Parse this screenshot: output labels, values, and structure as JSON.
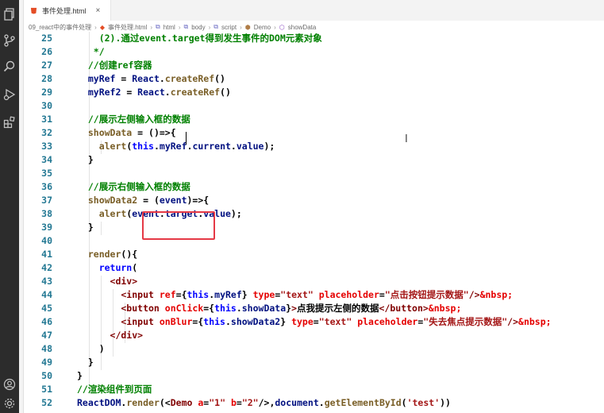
{
  "tab": {
    "title": "事件处理.html",
    "close": "×"
  },
  "breadcrumb": [
    "09_react中的事件处理",
    "事件处理.html",
    "html",
    "body",
    "script",
    "Demo",
    "showData"
  ],
  "lines": [
    {
      "n": "25",
      "segs": [
        [
          "c",
          "    (2).通过event.target得到发生事件的DOM元素对象"
        ]
      ]
    },
    {
      "n": "26",
      "segs": [
        [
          "c",
          "   */"
        ]
      ]
    },
    {
      "n": "27",
      "segs": [
        [
          "c",
          "  //创建ref容器"
        ]
      ]
    },
    {
      "n": "28",
      "segs": [
        [
          "v",
          "  myRef"
        ],
        [
          "p",
          " = "
        ],
        [
          "v",
          "React"
        ],
        [
          "p",
          "."
        ],
        [
          "f",
          "createRef"
        ],
        [
          "p",
          "()"
        ]
      ]
    },
    {
      "n": "29",
      "segs": [
        [
          "v",
          "  myRef2"
        ],
        [
          "p",
          " = "
        ],
        [
          "v",
          "React"
        ],
        [
          "p",
          "."
        ],
        [
          "f",
          "createRef"
        ],
        [
          "p",
          "()"
        ]
      ]
    },
    {
      "n": "30",
      "segs": []
    },
    {
      "n": "31",
      "segs": [
        [
          "c",
          "  //展示左侧输入框的数据"
        ]
      ]
    },
    {
      "n": "32",
      "segs": [
        [
          "f",
          "  showData"
        ],
        [
          "p",
          " = ()=>{"
        ]
      ]
    },
    {
      "n": "33",
      "segs": [
        [
          "f",
          "    alert"
        ],
        [
          "p",
          "("
        ],
        [
          "k",
          "this"
        ],
        [
          "p",
          "."
        ],
        [
          "v",
          "myRef"
        ],
        [
          "p",
          "."
        ],
        [
          "v",
          "current"
        ],
        [
          "p",
          "."
        ],
        [
          "v",
          "value"
        ],
        [
          "p",
          ");"
        ]
      ]
    },
    {
      "n": "34",
      "segs": [
        [
          "p",
          "  }"
        ]
      ]
    },
    {
      "n": "35",
      "segs": []
    },
    {
      "n": "36",
      "segs": [
        [
          "c",
          "  //展示右侧输入框的数据"
        ]
      ]
    },
    {
      "n": "37",
      "segs": [
        [
          "f",
          "  showData2"
        ],
        [
          "p",
          " = ("
        ],
        [
          "v",
          "event"
        ],
        [
          "p",
          ")=>{"
        ]
      ]
    },
    {
      "n": "38",
      "segs": [
        [
          "f",
          "    alert"
        ],
        [
          "p",
          "("
        ],
        [
          "v",
          "event"
        ],
        [
          "p",
          "."
        ],
        [
          "v",
          "target"
        ],
        [
          "p",
          "."
        ],
        [
          "v",
          "value"
        ],
        [
          "p",
          ");"
        ]
      ]
    },
    {
      "n": "39",
      "segs": [
        [
          "p",
          "  }"
        ]
      ]
    },
    {
      "n": "40",
      "segs": []
    },
    {
      "n": "41",
      "segs": [
        [
          "f",
          "  render"
        ],
        [
          "p",
          "(){"
        ]
      ]
    },
    {
      "n": "42",
      "segs": [
        [
          "k",
          "    return"
        ],
        [
          "p",
          "("
        ]
      ]
    },
    {
      "n": "43",
      "segs": [
        [
          "t",
          "      <div>"
        ]
      ]
    },
    {
      "n": "44",
      "segs": [
        [
          "t",
          "        <input"
        ],
        [
          "a",
          " ref"
        ],
        [
          "p",
          "={"
        ],
        [
          "k",
          "this"
        ],
        [
          "p",
          "."
        ],
        [
          "v",
          "myRef"
        ],
        [
          "p",
          "}"
        ],
        [
          "a",
          " type"
        ],
        [
          "p",
          "="
        ],
        [
          "s",
          "\"text\""
        ],
        [
          "a",
          " placeholder"
        ],
        [
          "p",
          "="
        ],
        [
          "s",
          "\"点击按钮提示数据\""
        ],
        [
          "t",
          "/>"
        ],
        [
          "a",
          "&nbsp;"
        ]
      ]
    },
    {
      "n": "45",
      "segs": [
        [
          "t",
          "        <button"
        ],
        [
          "a",
          " onClick"
        ],
        [
          "p",
          "={"
        ],
        [
          "k",
          "this"
        ],
        [
          "p",
          "."
        ],
        [
          "v",
          "showData"
        ],
        [
          "p",
          "}"
        ],
        [
          "t",
          ">"
        ],
        [
          "p",
          "点我提示左侧的数据"
        ],
        [
          "t",
          "</button>"
        ],
        [
          "a",
          "&nbsp;"
        ]
      ]
    },
    {
      "n": "46",
      "segs": [
        [
          "t",
          "        <input"
        ],
        [
          "a",
          " onBlur"
        ],
        [
          "p",
          "={"
        ],
        [
          "k",
          "this"
        ],
        [
          "p",
          "."
        ],
        [
          "v",
          "showData2"
        ],
        [
          "p",
          "}"
        ],
        [
          "a",
          " type"
        ],
        [
          "p",
          "="
        ],
        [
          "s",
          "\"text\""
        ],
        [
          "a",
          " placeholder"
        ],
        [
          "p",
          "="
        ],
        [
          "s",
          "\"失去焦点提示数据\""
        ],
        [
          "t",
          "/>"
        ],
        [
          "a",
          "&nbsp;"
        ]
      ]
    },
    {
      "n": "47",
      "segs": [
        [
          "t",
          "      </div>"
        ]
      ]
    },
    {
      "n": "48",
      "segs": [
        [
          "p",
          "    )"
        ]
      ]
    },
    {
      "n": "49",
      "segs": [
        [
          "p",
          "  }"
        ]
      ]
    },
    {
      "n": "50",
      "segs": [
        [
          "p",
          "}"
        ]
      ]
    },
    {
      "n": "51",
      "segs": [
        [
          "c",
          "//渲染组件到页面"
        ]
      ]
    },
    {
      "n": "52",
      "segs": [
        [
          "v",
          "ReactDOM"
        ],
        [
          "p",
          "."
        ],
        [
          "f",
          "render"
        ],
        [
          "p",
          "(<"
        ],
        [
          "t",
          "Demo"
        ],
        [
          "a",
          " a"
        ],
        [
          "p",
          "="
        ],
        [
          "s",
          "\"1\""
        ],
        [
          "a",
          " b"
        ],
        [
          "p",
          "="
        ],
        [
          "s",
          "\"2\""
        ],
        [
          "p",
          "/>,"
        ],
        [
          "v",
          "document"
        ],
        [
          "p",
          "."
        ],
        [
          "f",
          "getElementById"
        ],
        [
          "p",
          "("
        ],
        [
          "s",
          "'test'"
        ],
        [
          "p",
          "))"
        ]
      ]
    }
  ]
}
